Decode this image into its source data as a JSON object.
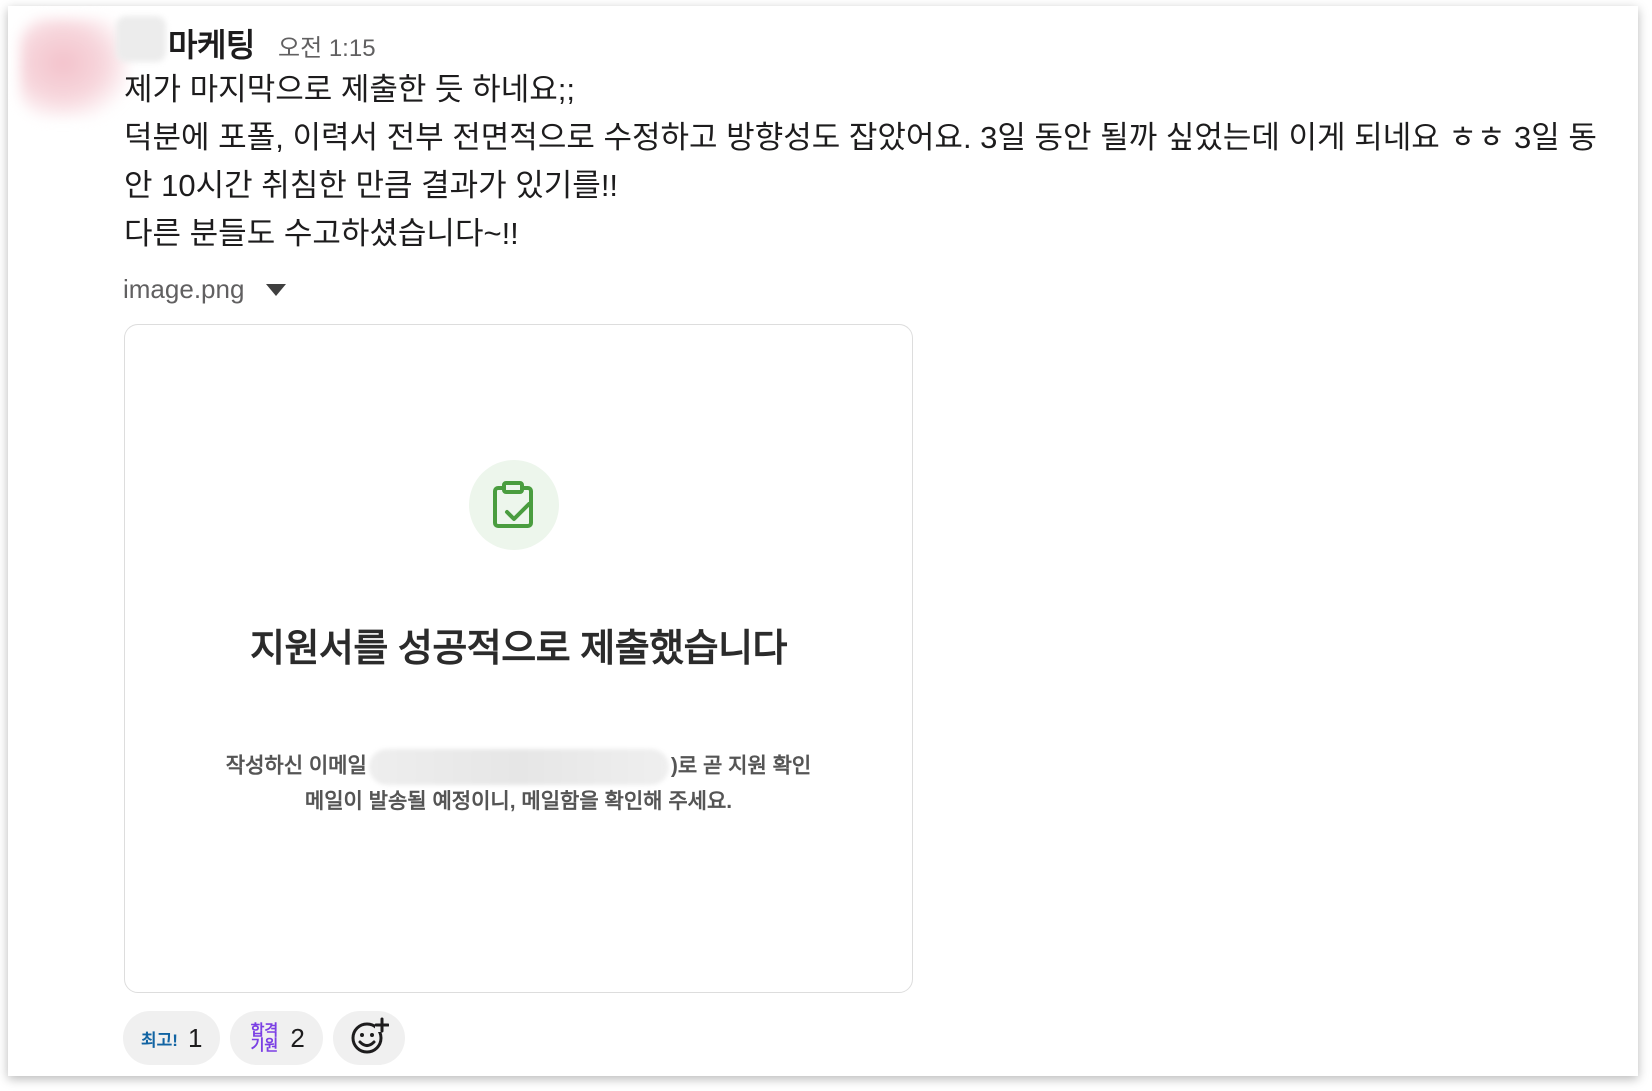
{
  "message": {
    "author": "마케팅",
    "time": "오전 1:15",
    "lines": [
      "제가 마지막으로 제출한 듯 하네요;;",
      "덕분에 포폴, 이력서 전부 전면적으로 수정하고 방향성도 잡았어요. 3일 동안 될까 싶었는데 이게 되네요 ㅎㅎ 3일 동안 10시간 취침한 만큼 결과가 있기를!!",
      "다른 분들도 수고하셨습니다~!!"
    ]
  },
  "attachment": {
    "filename": "image.png",
    "caret_icon": "caret-down-icon",
    "card": {
      "icon": "clipboard-check-icon",
      "icon_color": "#4a9d3f",
      "title": "지원서를 성공적으로 제출했습니다",
      "line1_prefix": "작성하신 이메일",
      "line1_suffix": ")로 곧 지원 확인",
      "line2": "메일이 발송될 예정이니, 메일함을 확인해 주세요."
    }
  },
  "reactions": [
    {
      "emoji": "최고!",
      "count": "1"
    },
    {
      "emoji_line1": "합격",
      "emoji_line2": "기원",
      "count": "2"
    }
  ],
  "add_reaction_icon": "add-reaction-icon"
}
